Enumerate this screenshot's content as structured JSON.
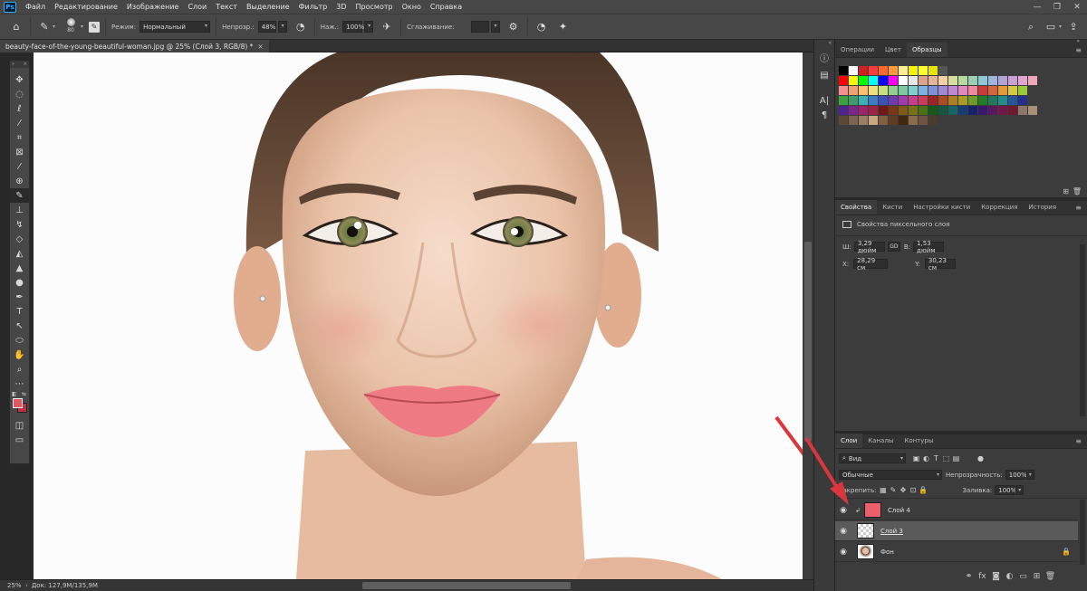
{
  "app": {
    "logo": "Ps"
  },
  "menu": [
    "Файл",
    "Редактирование",
    "Изображение",
    "Слои",
    "Текст",
    "Выделение",
    "Фильтр",
    "3D",
    "Просмотр",
    "Окно",
    "Справка"
  ],
  "options": {
    "brush_size": "80",
    "mode_label": "Режим:",
    "mode_value": "Нормальный",
    "opacity_label": "Непрозр.:",
    "opacity_value": "48%",
    "pressure_label": "Наж.:",
    "pressure_value": "100%",
    "smoothing_label": "Сглаживание:",
    "smoothing_value": ""
  },
  "document": {
    "tab_title": "beauty-face-of-the-young-beautiful-woman.jpg @ 25% (Слой 3, RGB/8) *",
    "zoom": "25%",
    "doc_info": "Док: 127,9M/135,9M"
  },
  "swatches_panel": {
    "tabs": [
      "Операции",
      "Цвет",
      "Образцы"
    ],
    "active_tab": "Образцы",
    "rows": [
      [
        "#000000",
        "#ffffff",
        "#cc2222",
        "#ff3a3a",
        "#ff6a2e",
        "#ff9a3a",
        "#ffee99",
        "#f4f400",
        "#ffff33",
        "#e6e600",
        "#555555"
      ],
      [
        "#ff0000",
        "#ffff00",
        "#00ff00",
        "#00ffff",
        "#0000ff",
        "#ff00ff",
        "#ffffff",
        "#e6e6e6",
        "#d9a58a",
        "#e6b29c",
        "#f3d0a8",
        "#d4df9c",
        "#b6dba0",
        "#9ad0b0",
        "#8cc8d4",
        "#9db5de",
        "#b0a4d6",
        "#c8a0d4",
        "#e0a6d0",
        "#f0a8b6"
      ],
      [
        "#f09090",
        "#f0a070",
        "#f8c070",
        "#f0e080",
        "#c8e080",
        "#90d090",
        "#80c8a0",
        "#80d0d0",
        "#80b0e0",
        "#8090d8",
        "#a088d0",
        "#c088d0",
        "#e088c0",
        "#f088a0",
        "#c83c3c",
        "#d8643c",
        "#e09c3c",
        "#d8c83c",
        "#9cc83c"
      ],
      [
        "#3ca03c",
        "#3c9c6c",
        "#3cb0b0",
        "#3c7cc8",
        "#3c50b8",
        "#6c3cb0",
        "#a03ca8",
        "#c83c8c",
        "#c83c5c",
        "#9c2424",
        "#a84c24",
        "#b07c24",
        "#a89c24",
        "#6c9c24",
        "#247c24",
        "#24785c",
        "#248c8c",
        "#24549c",
        "#24308c"
      ],
      [
        "#4c2490",
        "#7c2488",
        "#9c2468",
        "#9c2444",
        "#701818",
        "#783818",
        "#805818",
        "#787018",
        "#4c7018",
        "#185818",
        "#185440",
        "#186464",
        "#183c70",
        "#182268",
        "#381868",
        "#581860",
        "#701848",
        "#701830",
        "#8c7868",
        "#a89078"
      ],
      [
        "#5c4838",
        "#7c6450",
        "#9c8064",
        "#c8a880",
        "#806040",
        "#603c20",
        "#402810",
        "#8c6c4c",
        "#6c5440",
        "#4c3c30"
      ]
    ]
  },
  "properties_panel": {
    "tabs": [
      "Свойства",
      "Кисти",
      "Настройки кисти",
      "Коррекция",
      "История"
    ],
    "title": "Свойства пиксельного слоя",
    "w_label": "Ш:",
    "w_value": "3,29 дюйм",
    "link_symbol": "GD",
    "h_label": "В:",
    "h_value": "1,53 дюйм",
    "x_label": "X:",
    "x_value": "28,29 см",
    "y_label": "Y:",
    "y_value": "30,23 см"
  },
  "layers_panel": {
    "tabs": [
      "Слои",
      "Каналы",
      "Контуры"
    ],
    "filter_value": "Вид",
    "blend_mode": "Обычные",
    "opacity_label": "Непрозрачность:",
    "opacity_value": "100%",
    "lock_label": "Закрепить:",
    "fill_label": "Заливка:",
    "fill_value": "100%",
    "layers": [
      {
        "name": "Слой 4",
        "thumb": "#eb5e6c"
      },
      {
        "name": "Слой 3",
        "thumb": "checker"
      },
      {
        "name": "Фон",
        "thumb": "photo"
      }
    ]
  },
  "colors": {
    "foreground": "#e0555f",
    "background": "#c03240",
    "accent_arrow": "#d9363e"
  }
}
